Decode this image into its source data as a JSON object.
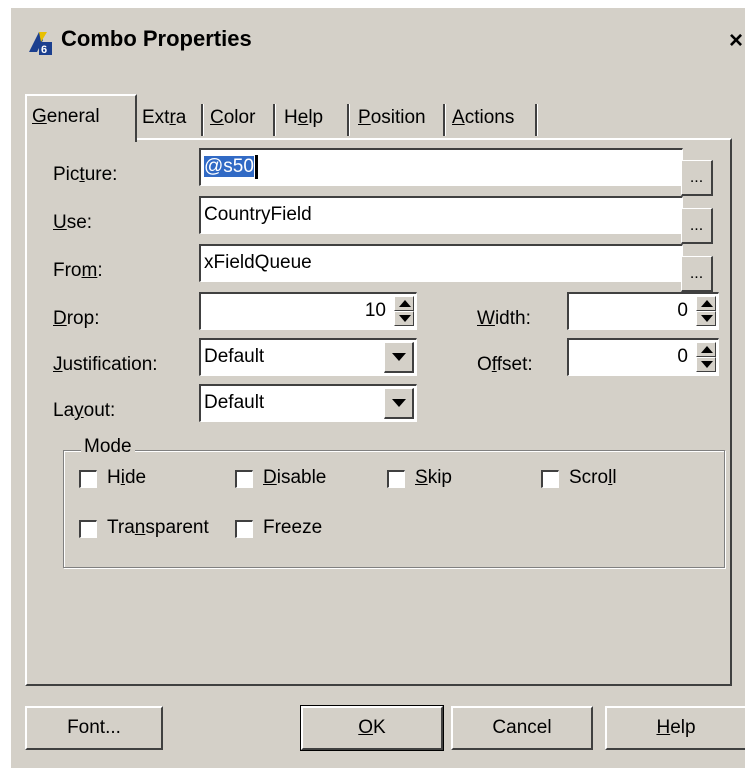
{
  "window": {
    "title": "Combo Properties",
    "close_label": "×"
  },
  "tabs": [
    {
      "pre": "",
      "u": "G",
      "post": "eneral"
    },
    {
      "pre": "Ext",
      "u": "r",
      "post": "a"
    },
    {
      "pre": "",
      "u": "C",
      "post": "olor"
    },
    {
      "pre": "H",
      "u": "e",
      "post": "lp"
    },
    {
      "pre": "",
      "u": "P",
      "post": "osition"
    },
    {
      "pre": "",
      "u": "A",
      "post": "ctions"
    }
  ],
  "fields": {
    "picture": {
      "pre": "Pic",
      "u": "t",
      "post": "ure:",
      "value": "@s50"
    },
    "use": {
      "pre": "",
      "u": "U",
      "post": "se:",
      "value": "CountryField"
    },
    "from": {
      "pre": "Fro",
      "u": "m",
      "post": ":",
      "value": "xFieldQueue"
    },
    "ellipsis": "..."
  },
  "drop": {
    "pre": "",
    "u": "D",
    "post": "rop:",
    "value": "10"
  },
  "width": {
    "pre": "",
    "u": "W",
    "post": "idth:",
    "value": "0"
  },
  "justification": {
    "pre": "",
    "u": "J",
    "post": "ustification:",
    "value": "Default"
  },
  "offset": {
    "pre": "O",
    "u": "f",
    "post": "fset:",
    "value": "0"
  },
  "layout": {
    "pre": "La",
    "u": "y",
    "post": "out:",
    "value": "Default"
  },
  "mode": {
    "title": "Mode",
    "options": [
      {
        "pre": "H",
        "u": "i",
        "post": "de",
        "checked": false
      },
      {
        "pre": "",
        "u": "D",
        "post": "isable",
        "checked": false
      },
      {
        "pre": "",
        "u": "S",
        "post": "kip",
        "checked": false
      },
      {
        "pre": "Scro",
        "u": "l",
        "post": "l",
        "checked": false
      },
      {
        "pre": "Tra",
        "u": "n",
        "post": "sparent",
        "checked": false
      },
      {
        "pre": "",
        "u": "",
        "post": "Freeze",
        "checked": false
      }
    ]
  },
  "buttons": {
    "font": "Font...",
    "ok": {
      "pre": "",
      "u": "O",
      "post": "K"
    },
    "cancel": "Cancel",
    "help": {
      "pre": "",
      "u": "H",
      "post": "elp"
    }
  },
  "colors": {
    "face": "#d4d0c8",
    "shadow": "#404040",
    "highlight": "#ffffff",
    "selection": "#316ac5"
  }
}
